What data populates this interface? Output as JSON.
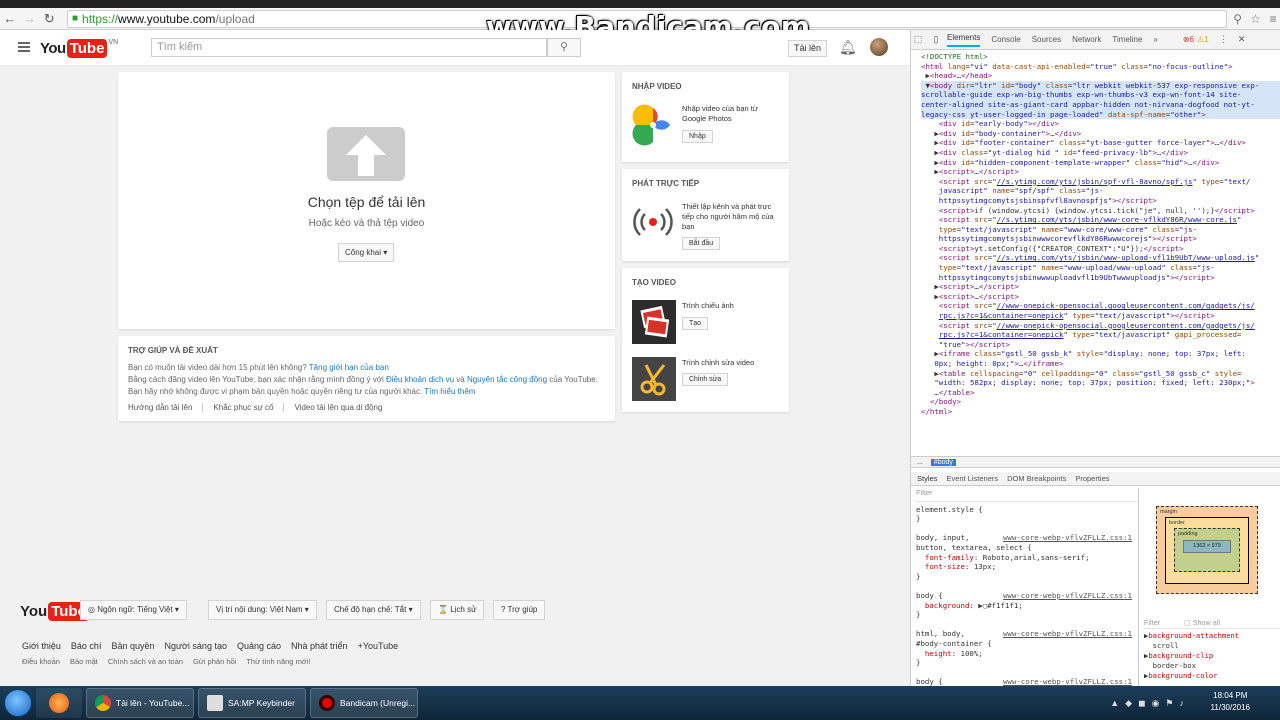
{
  "browser": {
    "url_scheme": "https://",
    "url_host": "www.youtube.com",
    "url_path": "/upload",
    "back_icon": "back-arrow-icon",
    "forward_icon": "forward-arrow-icon",
    "reload_icon": "reload-icon"
  },
  "watermark": "www.Bandicam.com",
  "header": {
    "logo_you": "You",
    "logo_tube": "Tube",
    "logo_region": "VN",
    "search_placeholder": "Tìm kiếm",
    "upload_label": "Tải lên"
  },
  "upload": {
    "title": "Chọn tệp để tải lên",
    "subtitle": "Hoặc kéo và thả tệp video",
    "privacy_label": "Công khai"
  },
  "help": {
    "title": "TRỢ GIÚP VÀ ĐỀ XUẤT",
    "line1_text": "Bạn có muốn tải video dài hơn 15 phút lên không? ",
    "line1_link": "Tăng giới hạn của bạn",
    "line2_a": "Bằng cách đăng video lên YouTube, bạn xác nhận rằng mình đồng ý với ",
    "line2_link1": "Điều khoản dịch vụ",
    "line2_b": " và ",
    "line2_link2": "Nguyên tắc cộng đồng",
    "line2_c": " của YouTube.",
    "line3_text": "Bạn hãy nhớ không được vi phạm bản quyền hoặc quyền riêng tư của người khác. ",
    "line3_link": "Tìm hiểu thêm",
    "links": [
      "Hướng dẫn tải lên",
      "Khắc phục sự cố",
      "Video tải lên qua di động"
    ]
  },
  "side": {
    "import": {
      "title": "NHẬP VIDEO",
      "text": "Nhập video của bạn từ Google Photos",
      "button": "Nhập"
    },
    "live": {
      "title": "PHÁT TRỰC TIẾP",
      "text": "Thiết lập kênh và phát trực tiếp cho người hâm mộ của bạn",
      "button": "Bắt đầu"
    },
    "create": {
      "title": "TẠO VIDEO",
      "slideshow_text": "Trình chiếu ảnh",
      "slideshow_button": "Tạo",
      "editor_text": "Trình chỉnh sửa video",
      "editor_button": "Chỉnh sửa"
    }
  },
  "footer": {
    "logo_you": "You",
    "logo_tube": "Tube",
    "buttons": [
      "Ngôn ngữ: Tiếng Việt",
      "Vị trí nội dung: Việt Nam",
      "Chế độ hạn chế: Tắt",
      "Lịch sử",
      "Trợ giúp"
    ],
    "links1": [
      "Giới thiệu",
      "Báo chí",
      "Bản quyền",
      "Người sáng tạo",
      "Quảng cáo",
      "Nhà phát triển",
      "+YouTube"
    ],
    "links2": [
      "Điều khoản",
      "Bảo mật",
      "Chính sách và an toàn",
      "Gửi phản hồi",
      "Thử tính năng mới!"
    ]
  },
  "devtools": {
    "tabs": [
      "Elements",
      "Console",
      "Sources",
      "Network",
      "Timeline"
    ],
    "more": "»",
    "errors": "⊗6",
    "warnings": "⚠1",
    "crumb_dots": "...",
    "crumb_current": "#body",
    "style_tabs": [
      "Styles",
      "Event Listeners",
      "DOM Breakpoints",
      "Properties"
    ],
    "filter_label": "Filter",
    "computed_filter": "Filter",
    "show_all": "Show all",
    "box_margin": "margin",
    "box_border": "border",
    "box_padding": "padding",
    "box_content": "1362 × 979",
    "box_dash": "-"
  },
  "taskbar": {
    "apps": [
      "Tải lên - YouTube...",
      "SA:MP Keybinder",
      "Bandicam (Unregi..."
    ],
    "time": "18:04 PM",
    "date": "11/30/2016"
  }
}
